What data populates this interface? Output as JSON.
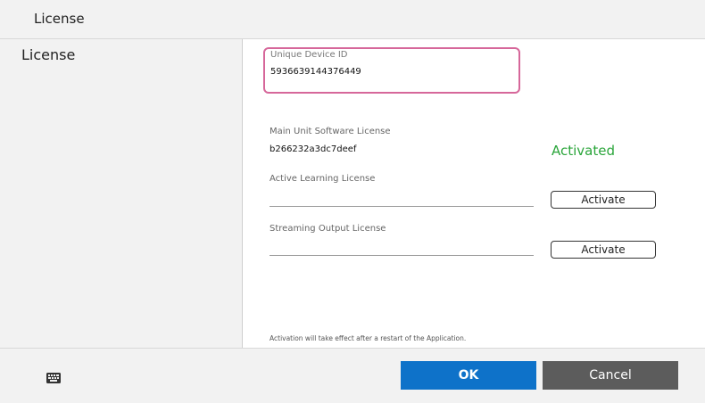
{
  "window": {
    "title": "License"
  },
  "sidebar": {
    "items": [
      {
        "label": "License"
      }
    ]
  },
  "license": {
    "device_id": {
      "label": "Unique Device ID",
      "value": "5936639144376449"
    },
    "main_unit": {
      "label": "Main Unit Software License",
      "value": "b266232a3dc7deef",
      "status": "Activated"
    },
    "active_learning": {
      "label": "Active Learning License",
      "value": "",
      "button_label": "Activate"
    },
    "streaming_output": {
      "label": "Streaming Output License",
      "value": "",
      "button_label": "Activate"
    },
    "notice": "Activation will take effect after a restart of the Application."
  },
  "footer": {
    "icon": "keyboard-icon",
    "ok_label": "OK",
    "cancel_label": "Cancel"
  },
  "colors": {
    "highlight_border": "#d6679a",
    "activated": "#2aa53a",
    "ok_button": "#0e72c9",
    "cancel_button": "#5c5c5c"
  }
}
